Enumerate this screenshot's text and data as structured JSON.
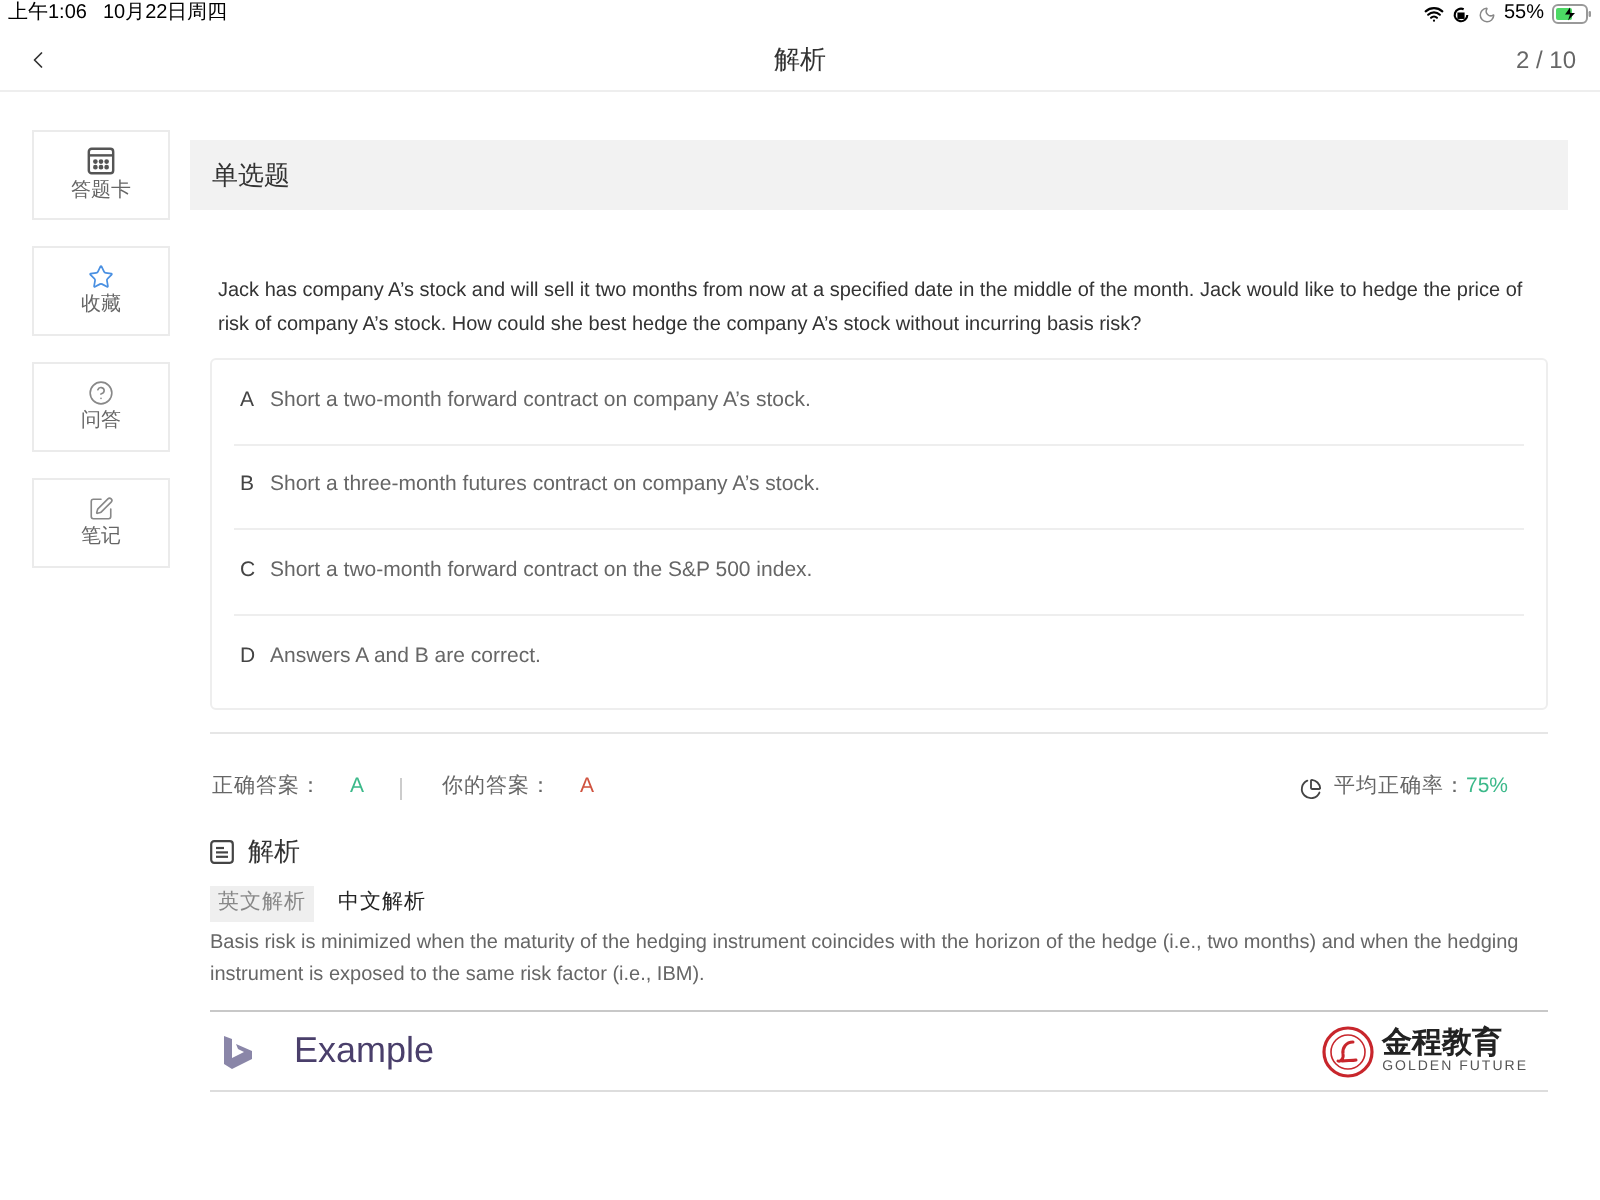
{
  "status_bar": {
    "time": "上午1:06",
    "date": "10月22日周四",
    "battery": "55%"
  },
  "nav": {
    "title": "解析",
    "counter": "2 / 10"
  },
  "sidebar": {
    "items": [
      {
        "kind": "answer_card",
        "label": "答题卡"
      },
      {
        "kind": "favorite",
        "label": "收藏"
      },
      {
        "kind": "qa",
        "label": "问答"
      },
      {
        "kind": "notes",
        "label": "笔记"
      }
    ]
  },
  "question": {
    "type_label": "单选题",
    "text": "Jack has company A’s stock and will sell it two months from now at a specified date in the middle of the month. Jack would like to hedge the price of risk of company A’s stock. How could she best hedge the company A’s stock without incurring basis risk?",
    "options": [
      {
        "letter": "A",
        "text": "Short a two-month forward contract on company A’s stock."
      },
      {
        "letter": "B",
        "text": "Short a three-month futures contract on company A’s stock."
      },
      {
        "letter": "C",
        "text": "Short a two-month forward contract on the S&P 500 index."
      },
      {
        "letter": "D",
        "text": "Answers A and B are correct."
      }
    ]
  },
  "result": {
    "correct_label": "正确答案：",
    "correct_answer": "A",
    "your_label": "你的答案：",
    "your_answer": "A",
    "average_label": "平均正确率：",
    "average_value": "75%"
  },
  "analysis": {
    "title": "解析",
    "tabs": [
      {
        "label": "英文解析",
        "selected": true
      },
      {
        "label": "中文解析",
        "selected": false
      }
    ],
    "text": "Basis risk is minimized when the maturity of the hedging instrument coincides with the horizon of the hedge (i.e., two months) and when the hedging instrument is exposed to the same risk factor (i.e., IBM).",
    "slide": {
      "title": "Example",
      "logo_name": "金程教育",
      "logo_subtitle": "GOLDEN FUTURE"
    }
  }
}
